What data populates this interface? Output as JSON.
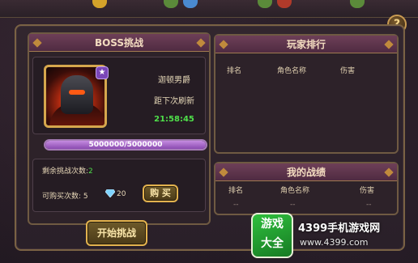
{
  "help": {
    "label": "?"
  },
  "boss_panel": {
    "title": "BOSS挑战",
    "boss_name": "迦顿男爵",
    "refresh_label": "距下次刷新",
    "countdown": "21:58:45",
    "hp_text": "5000000/5000000",
    "hp_fraction": 1.0,
    "remaining_label": "剩余挑战次数:",
    "remaining_value": "2",
    "buy_label": "可购买次数: 5",
    "gem_cost": "20",
    "buy_button": "购 买",
    "start_button": "开始挑战"
  },
  "ranking_panel": {
    "title": "玩家排行",
    "columns": [
      "排名",
      "角色名称",
      "伤害"
    ]
  },
  "my_panel": {
    "title": "我的战绩",
    "columns": [
      "排名",
      "角色名称",
      "伤害"
    ],
    "values": [
      "--",
      "--",
      "--"
    ]
  },
  "watermark": {
    "logo_line1": "游戏",
    "logo_line2": "大全",
    "site_name": "4399手机游戏网",
    "url": "www.4399.com"
  },
  "colors": {
    "accent_gold": "#d6a74d",
    "title_purple": "#6e3f58",
    "countdown_green": "#4fe04a",
    "hp_purple": "#c58be0"
  }
}
